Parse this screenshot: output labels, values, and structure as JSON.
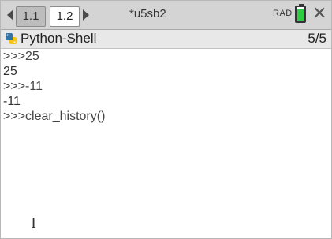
{
  "tabs": [
    {
      "label": "1.1",
      "active": false
    },
    {
      "label": "1.2",
      "active": true
    }
  ],
  "document_title": "*u5sb2",
  "angle_mode": "RAD",
  "battery_level": 0.9,
  "app": {
    "title": "Python-Shell",
    "page_count": "5/5"
  },
  "console": {
    "lines": [
      {
        "text": ">>>25"
      },
      {
        "text": "25"
      },
      {
        "text": ">>>-11"
      },
      {
        "text": "-11"
      },
      {
        "text": ">>>clear_history()"
      }
    ]
  },
  "icons": {
    "nav_left": "triangle-left",
    "nav_right": "triangle-right",
    "close": "close-x",
    "python": "python-logo",
    "cursor": "text-ibeam"
  },
  "colors": {
    "tabbar_bg": "#d4d4d4",
    "battery_fill": "#2ecc40",
    "python_blue": "#3572a5",
    "python_yellow": "#f5c518"
  }
}
